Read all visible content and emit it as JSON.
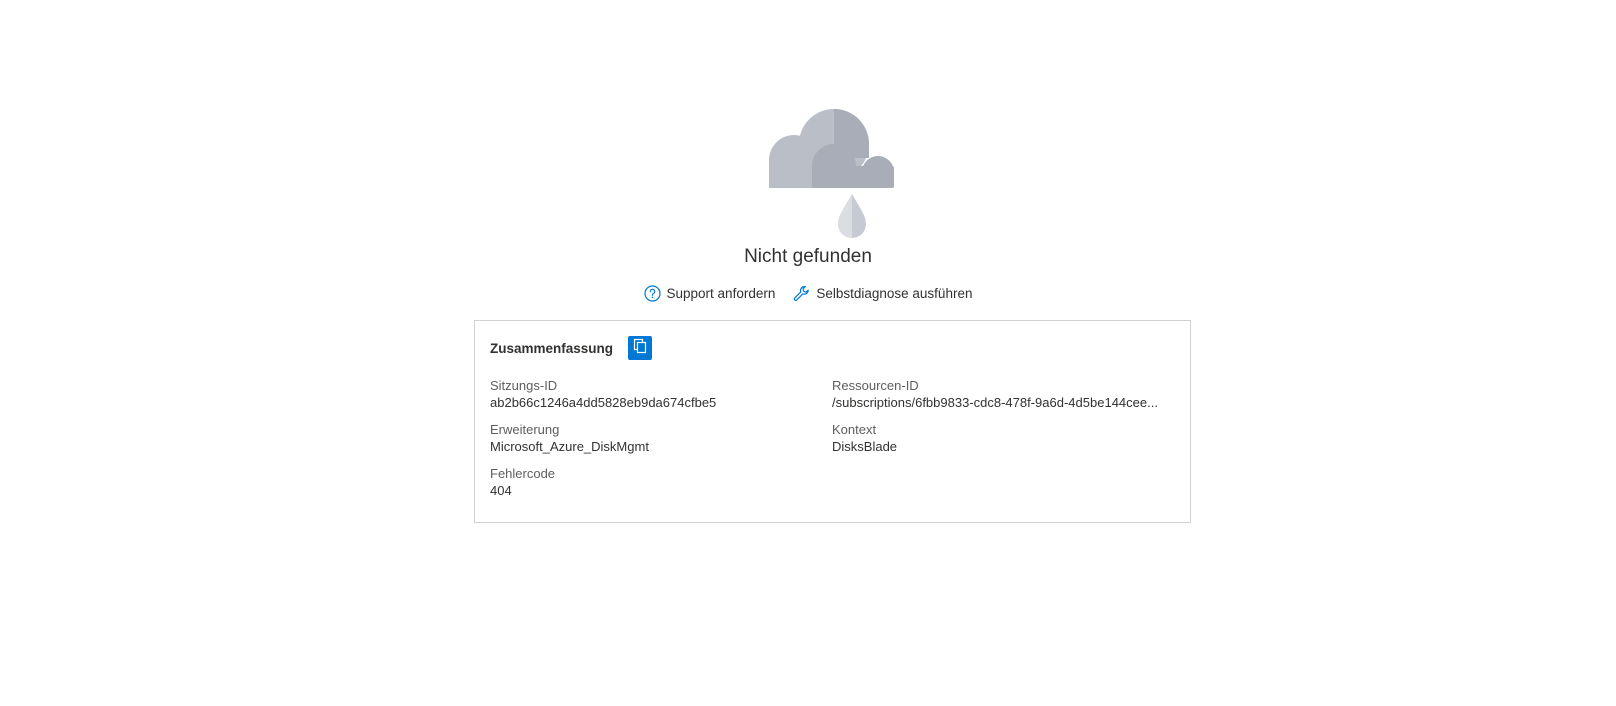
{
  "error": {
    "title": "Nicht gefunden",
    "illustration": "cloud-rain-icon"
  },
  "actions": [
    {
      "label": "Support anfordern",
      "icon": "help-circle-icon"
    },
    {
      "label": "Selbstdiagnose ausführen",
      "icon": "wrench-icon"
    }
  ],
  "summary": {
    "title": "Zusammenfassung",
    "copy_icon": "copy-icon",
    "fields": {
      "session_id": {
        "label": "Sitzungs-ID",
        "value": "ab2b66c1246a4dd5828eb9da674cfbe5"
      },
      "resource_id": {
        "label": "Ressourcen-ID",
        "value": "/subscriptions/6fbb9833-cdc8-478f-9a6d-4d5be144cee..."
      },
      "extension": {
        "label": "Erweiterung",
        "value": "Microsoft_Azure_DiskMgmt"
      },
      "context": {
        "label": "Kontext",
        "value": "DisksBlade"
      },
      "error_code": {
        "label": "Fehlercode",
        "value": "404"
      }
    }
  },
  "colors": {
    "accent": "#0078d4",
    "cloud_light": "#b9bec7",
    "cloud_dark": "#a8adb8",
    "border": "#d2d0ce"
  }
}
